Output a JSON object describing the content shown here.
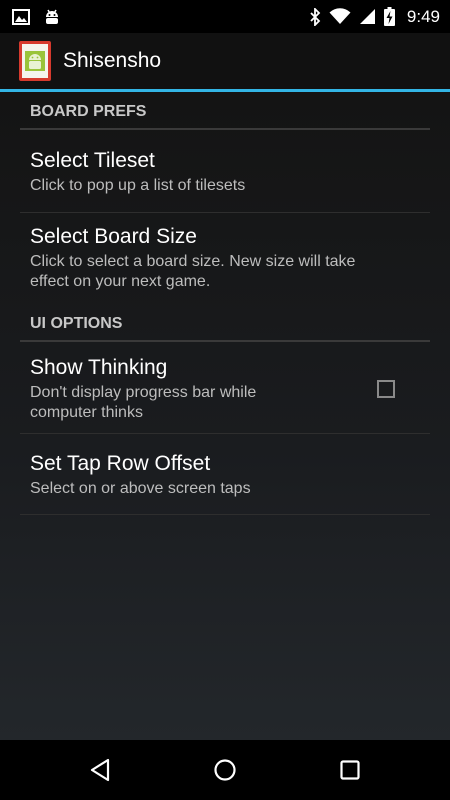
{
  "status_bar": {
    "time": "9:49",
    "left_icons": [
      "image-icon",
      "android-debug-icon"
    ],
    "right_icons": [
      "bluetooth-icon",
      "wifi-icon",
      "signal-icon",
      "battery-charging-icon"
    ]
  },
  "action_bar": {
    "title": "Shisensho",
    "icon": "app-icon",
    "accent_color": "#33b5e5"
  },
  "sections": [
    {
      "header": "BOARD PREFS",
      "items": [
        {
          "title": "Select Tileset",
          "summary": "Click to pop up a list of tilesets"
        },
        {
          "title": "Select Board Size",
          "summary_line1": "Click to select a board size. New size will take",
          "summary_line2": "effect on your next game."
        }
      ]
    },
    {
      "header": "UI OPTIONS",
      "items": [
        {
          "title": "Show Thinking",
          "summary_line1": "Don't display progress bar while",
          "summary_line2": "computer thinks",
          "checked": false
        },
        {
          "title": "Set Tap Row Offset",
          "summary": "Select on or above screen taps"
        }
      ]
    }
  ],
  "nav_bar": {
    "buttons": [
      "back-icon",
      "home-icon",
      "recents-icon"
    ]
  }
}
